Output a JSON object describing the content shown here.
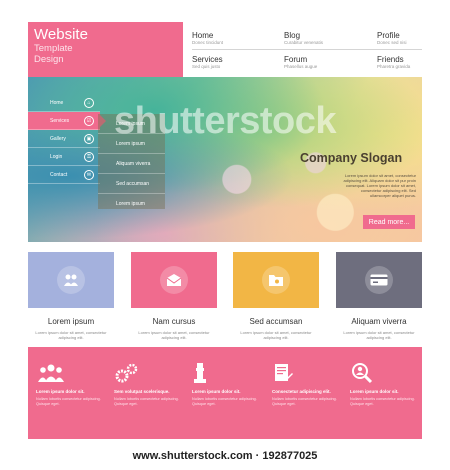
{
  "logo": {
    "title": "Website",
    "line1": "Template",
    "line2": "Design"
  },
  "nav": [
    {
      "title": "Home",
      "sub": "Donec tincidunt"
    },
    {
      "title": "Blog",
      "sub": "Curabitur venenatis"
    },
    {
      "title": "Profile",
      "sub": "Donec sed nisi"
    },
    {
      "title": "Services",
      "sub": "Sed quis justo"
    },
    {
      "title": "Forum",
      "sub": "Phasellus augue"
    },
    {
      "title": "Friends",
      "sub": "Pharetra gravida"
    }
  ],
  "side_menu": [
    {
      "label": "Home",
      "icon": "home-icon",
      "glyph": "⌂"
    },
    {
      "label": "Services",
      "icon": "checkbox-icon",
      "glyph": "☑"
    },
    {
      "label": "Gallery",
      "icon": "gallery-icon",
      "glyph": "▣"
    },
    {
      "label": "Login",
      "icon": "key-icon",
      "glyph": "⚿"
    },
    {
      "label": "Contact",
      "icon": "mail-icon",
      "glyph": "✉"
    }
  ],
  "sub_menu": [
    "Lorem ipsum",
    "Lorem ipsum",
    "Aliquam viverra",
    "Sed accumsan",
    "Lorem ipsum"
  ],
  "hero": {
    "slogan": "Company Slogan",
    "text": "Lorem ipsum dolor sit amet, consectetur adipiscing elit. Aliquam dolor sit pur proin consequat. Lorem ipsum dolor sit amet, consectetur adipiscing elit. Sed ullamcorper aliquet purus.",
    "button": "Read more..."
  },
  "features": [
    {
      "title": "Lorem ipsum",
      "text": "Lorem ipsum dolor sit amet, consectetur adipiscing elit.",
      "color": "#a4b1dd",
      "icon": "users-icon"
    },
    {
      "title": "Nam cursus",
      "text": "Lorem ipsum dolor sit amet, consectetur adipiscing elit.",
      "color": "#f06b8e",
      "icon": "envelope-icon"
    },
    {
      "title": "Sed accumsan",
      "text": "Lorem ipsum dolor sit amet, consectetur adipiscing elit.",
      "color": "#f2b645",
      "icon": "folder-icon"
    },
    {
      "title": "Aliquam viverra",
      "text": "Lorem ipsum dolor sit amet, consectetur adipiscing elit.",
      "color": "#6e6e7e",
      "icon": "credit-card-icon"
    }
  ],
  "band": [
    {
      "title": "Lorem ipsum dolor sit.",
      "text": "Nullam lobortis consectetur adipiscing. Quisque eget.",
      "icon": "team-icon"
    },
    {
      "title": "Sem volutpat scelerisque.",
      "text": "Nullam lobortis consectetur adipiscing. Quisque eget.",
      "icon": "gears-icon"
    },
    {
      "title": "Lorem ipsum dolor sit.",
      "text": "Nullam lobortis consectetur adipiscing. Quisque eget.",
      "icon": "chess-icon"
    },
    {
      "title": "Consectetur adipiscing elit.",
      "text": "Nullam lobortis consectetur adipiscing. Quisque eget.",
      "icon": "document-icon"
    },
    {
      "title": "Lorem ipsum dolor sit.",
      "text": "Nullam lobortis consectetur adipiscing. Quisque eget.",
      "icon": "search-user-icon"
    }
  ],
  "watermark": "shutterstock",
  "footer_url": "www.shutterstock.com · 192877025"
}
